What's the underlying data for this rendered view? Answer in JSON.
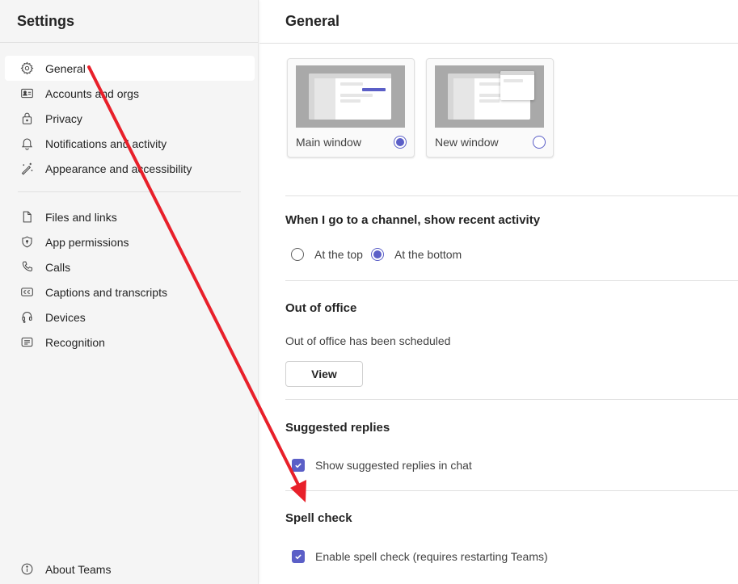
{
  "sidebar": {
    "title": "Settings",
    "group1": [
      {
        "label": "General",
        "icon": "gear-icon",
        "active": true
      },
      {
        "label": "Accounts and orgs",
        "icon": "id-card-icon"
      },
      {
        "label": "Privacy",
        "icon": "lock-icon"
      },
      {
        "label": "Notifications and activity",
        "icon": "bell-icon"
      },
      {
        "label": "Appearance and accessibility",
        "icon": "magic-wand-icon"
      }
    ],
    "group2": [
      {
        "label": "Files and links",
        "icon": "document-icon"
      },
      {
        "label": "App permissions",
        "icon": "shield-icon"
      },
      {
        "label": "Calls",
        "icon": "phone-icon"
      },
      {
        "label": "Captions and transcripts",
        "icon": "closed-captions-icon"
      },
      {
        "label": "Devices",
        "icon": "headset-icon"
      },
      {
        "label": "Recognition",
        "icon": "text-box-icon"
      }
    ],
    "about": {
      "label": "About Teams",
      "icon": "info-icon"
    }
  },
  "main": {
    "title": "General",
    "open_options": [
      {
        "label": "Main window",
        "selected": true
      },
      {
        "label": "New window",
        "selected": false
      }
    ],
    "channel_activity": {
      "title": "When I go to a channel, show recent activity",
      "options": [
        {
          "label": "At the top",
          "selected": false
        },
        {
          "label": "At the bottom",
          "selected": true
        }
      ]
    },
    "out_of_office": {
      "title": "Out of office",
      "status": "Out of office has been scheduled",
      "button": "View"
    },
    "suggested_replies": {
      "title": "Suggested replies",
      "checkbox_label": "Show suggested replies in chat",
      "checked": true
    },
    "spell_check": {
      "title": "Spell check",
      "checkbox_label": "Enable spell check (requires restarting Teams)",
      "checked": true
    }
  },
  "colors": {
    "brand": "#5b5fc7",
    "annotation_arrow": "#e8202a",
    "sidebar_bg": "#f5f5f5"
  },
  "annotation": {
    "type": "arrow",
    "from": "sidebar-item-general",
    "to": "spell-check-section"
  }
}
